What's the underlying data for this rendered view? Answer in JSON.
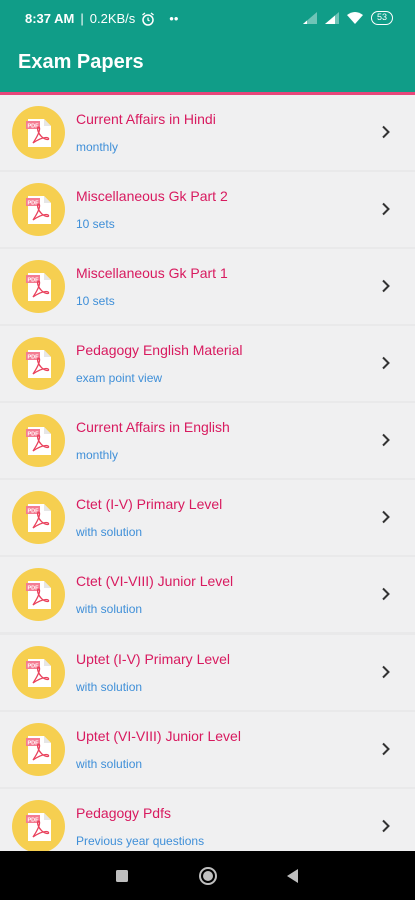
{
  "status": {
    "time": "8:37 AM",
    "speed": "0.2KB/s",
    "battery": "53",
    "dots": "••"
  },
  "appbar": {
    "title": "Exam Papers"
  },
  "items": [
    {
      "name": "Current Affairs in Hindi",
      "sub": "monthly"
    },
    {
      "name": "Miscellaneous Gk Part 2",
      "sub": "10 sets"
    },
    {
      "name": "Miscellaneous Gk Part 1",
      "sub": "10 sets"
    },
    {
      "name": "Pedagogy English Material",
      "sub": "exam point view"
    },
    {
      "name": "Current Affairs in English",
      "sub": "monthly"
    },
    {
      "name": "Ctet (I-V) Primary Level",
      "sub": "with solution"
    },
    {
      "name": "Ctet (VI-VIII) Junior Level",
      "sub": "with solution"
    },
    {
      "name": "Uptet (I-V) Primary Level",
      "sub": "with solution"
    },
    {
      "name": "Uptet (VI-VIII) Junior Level",
      "sub": "with solution"
    },
    {
      "name": "Pedagogy Pdfs",
      "sub": "Previous year questions"
    }
  ],
  "pdf_badge_text": "PDF",
  "colors": {
    "primary": "#109d88",
    "accent": "#e8467a",
    "title_text": "#d81a5f",
    "sub_text": "#3f8fd8",
    "icon_bg": "#f6cf50"
  },
  "icons": {
    "item": "pdf-file-icon",
    "chevron": "chevron-right-icon"
  }
}
